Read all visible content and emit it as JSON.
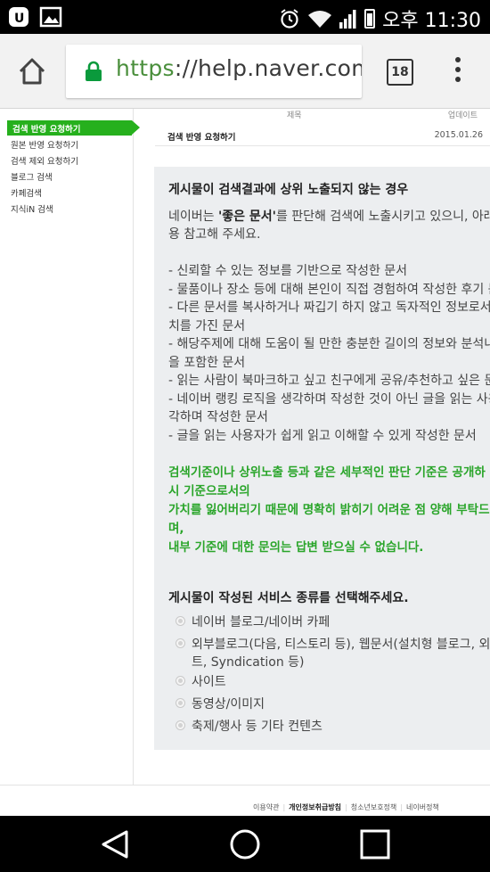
{
  "status_bar": {
    "time": "오후 11:30",
    "icons": [
      "u-plus-icon",
      "gallery-icon",
      "alarm-icon",
      "wifi-icon",
      "signal-icon",
      "battery-icon"
    ]
  },
  "browser": {
    "url_scheme": "https",
    "url_rest": "://help.naver.com/s",
    "tab_count": "18"
  },
  "sidebar": {
    "active_item": "검색 반영 요청하기",
    "items": [
      "원본 반영 요청하기",
      "검색 제외 요청하기",
      "블로그 검색",
      "카페검색",
      "지식iN 검색"
    ]
  },
  "table": {
    "col_title": "제목",
    "col_updated": "업데이트",
    "row_title": "검색 반영 요청하기",
    "row_date": "2015.01.26"
  },
  "article": {
    "heading": "게시물이 검색결과에 상위 노출되지 않는 경우",
    "intro_pre": "네이버는 ",
    "intro_bold": "'좋은 문서'",
    "intro_post": "를 판단해 검색에 노출시키고 있으니, 아래 내",
    "intro_line2": "용 참고해 주세요.",
    "bullets": [
      "- 신뢰할 수 있는 정보를 기반으로 작성한 문서",
      "- 물품이나 장소 등에 대해 본인이 직접 경험하여 작성한 후기 문",
      "- 다른 문서를 복사하거나 짜깁기 하지 않고 독자적인 정보로서의",
      "치를 가진 문서",
      "- 해당주제에 대해 도움이 될 만한 충분한 길이의 정보와 분석내용",
      "을 포함한 문서",
      "- 읽는 사람이 북마크하고 싶고 친구에게 공유/추천하고 싶은 문서",
      "- 네이버 랭킹 로직을 생각하며 작성한 것이 아닌 글을 읽는 사용자",
      "각하며 작성한 문서",
      "- 글을 읽는 사용자가 쉽게 읽고 이해할 수 있게 작성한 문서"
    ],
    "notice": [
      "검색기준이나 상위노출 등과 같은 세부적인 판단 기준은 공개하",
      "시 기준으로서의",
      "가치를 잃어버리기 때문에 명확히 밝히기 어려운 점 양해 부탁드",
      "며,",
      "내부 기준에 대한 문의는 답변 받으실 수 없습니다."
    ],
    "question": "게시물이 작성된 서비스 종류를 선택해주세요.",
    "options": [
      "네이버 블로그/네이버 카페",
      "외부블로그(다음, 티스토리 등), 웹문서(설치형 블로그, 외부",
      "트, Syndication 등)",
      "사이트",
      "동영상/이미지",
      "축제/행사 등 기타 컨텐츠"
    ]
  },
  "footer": {
    "links": [
      "이용약관",
      "개인정보취급방침",
      "청소년보호정책",
      "네이버정책"
    ]
  },
  "nav_bar": {
    "buttons": [
      "back-icon",
      "home-icon",
      "recents-icon"
    ]
  }
}
